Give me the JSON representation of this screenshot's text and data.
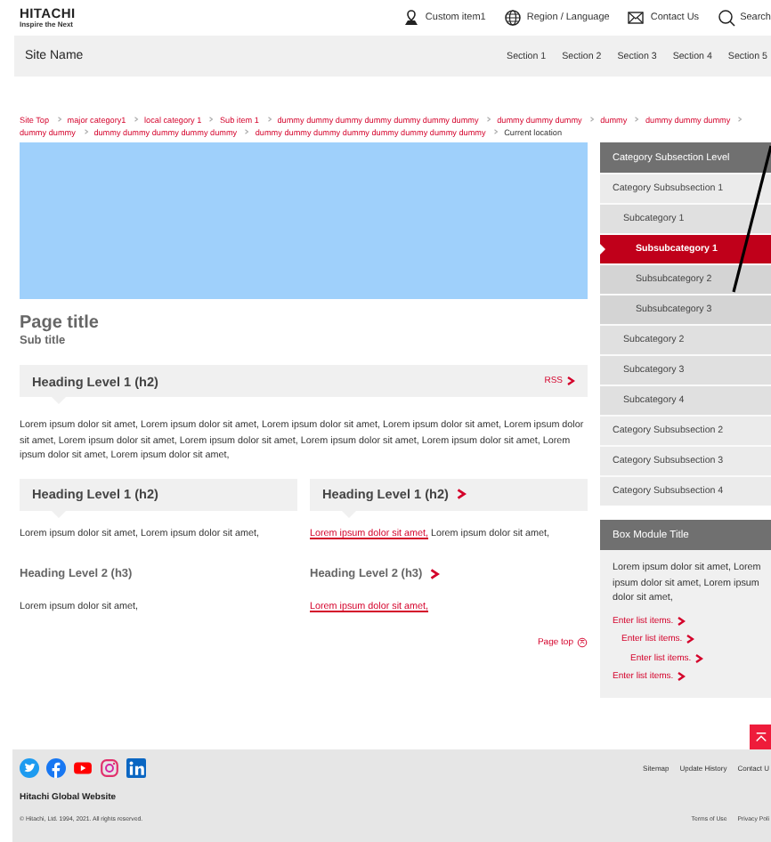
{
  "header": {
    "logo": "HITACHI",
    "tagline": "Inspire the Next",
    "utility_links": [
      {
        "label": "Custom item1",
        "kind": "pin"
      },
      {
        "label": "Region / Language",
        "kind": "globe"
      },
      {
        "label": "Contact Us",
        "kind": "mail"
      },
      {
        "label": "Search",
        "kind": "search"
      }
    ],
    "site_name": "Site Name",
    "sections": [
      "Section 1",
      "Section 2",
      "Section 3",
      "Section 4",
      "Section 5"
    ]
  },
  "breadcrumb": [
    {
      "label": "Site Top",
      "current": false
    },
    {
      "label": "major category1",
      "current": false
    },
    {
      "label": "local category 1",
      "current": false
    },
    {
      "label": "Sub item 1",
      "current": false
    },
    {
      "label": "dummy dummy dummy dummy dummy dummy dummy",
      "current": false
    },
    {
      "label": "dummy dummy dummy",
      "current": false
    },
    {
      "label": "dummy",
      "current": false
    },
    {
      "label": "dummy dummy dummy",
      "current": false
    },
    {
      "label": "dummy dummy",
      "current": false
    },
    {
      "label": "dummy dummy dummy dummy dummy",
      "current": false
    },
    {
      "label": "dummy dummy dummy dummy dummy dummy dummy dummy",
      "current": false
    },
    {
      "label": "Current location",
      "current": true
    }
  ],
  "page_title": "Page title",
  "sub_title": "Sub title",
  "section": {
    "heading": "Heading Level 1 (h2)",
    "rss": "RSS",
    "text": "Lorem ipsum dolor sit amet, Lorem ipsum dolor sit amet, Lorem ipsum dolor sit amet, Lorem ipsum dolor sit amet, Lorem ipsum dolor sit amet, Lorem ipsum dolor sit amet, Lorem ipsum dolor sit amet, Lorem ipsum dolor sit amet, Lorem ipsum dolor sit amet, Lorem ipsum dolor sit amet, Lorem ipsum dolor sit amet,"
  },
  "columns": [
    {
      "heading": "Heading Level 1 (h2)",
      "linked": false,
      "text": {
        "rest": "Lorem ipsum dolor sit amet, Lorem ipsum dolor sit amet,"
      },
      "subheading": "Heading Level 2 (h3)",
      "subtext": {
        "rest": "Lorem ipsum dolor sit amet,"
      }
    },
    {
      "heading": "Heading Level 1 (h2)",
      "linked": true,
      "text": {
        "link": "Lorem ipsum dolor sit amet,",
        "rest": " Lorem ipsum dolor sit amet,"
      },
      "subheading": "Heading Level 2 (h3)",
      "subtext": {
        "link": "Lorem ipsum dolor sit amet,"
      }
    }
  ],
  "page_top": "Page top",
  "sidebar": {
    "title": "Category Subsection Level",
    "items": [
      {
        "label": "Category Subsubsection 1",
        "selected": false,
        "children": [
          {
            "label": "Subcategory 1",
            "selected": false,
            "children": [
              {
                "label": "Subsubcategory 1",
                "selected": true
              },
              {
                "label": "Subsubcategory 2",
                "selected": false
              },
              {
                "label": "Subsubcategory 3",
                "selected": false
              }
            ]
          },
          {
            "label": "Subcategory 2",
            "selected": false
          },
          {
            "label": "Subcategory 3",
            "selected": false
          },
          {
            "label": "Subcategory 4",
            "selected": false
          }
        ]
      },
      {
        "label": "Category Subsubsection 2",
        "selected": false
      },
      {
        "label": "Category Subsubsection 3",
        "selected": false
      },
      {
        "label": "Category Subsubsection 4",
        "selected": false
      }
    ]
  },
  "box_module": {
    "title": "Box Module Title",
    "text": "Lorem ipsum dolor sit amet, Lorem ipsum dolor sit amet, Lorem ipsum dolor sit amet,",
    "links": [
      {
        "label": "Enter list items.",
        "children": [
          {
            "label": "Enter list items.",
            "children": [
              {
                "label": "Enter list items."
              }
            ]
          }
        ]
      },
      {
        "label": "Enter list items."
      }
    ]
  },
  "footer": {
    "links": [
      "Sitemap",
      "Update History",
      "Contact U"
    ],
    "site": "Hitachi Global Website",
    "copyright": "© Hitachi, Ltd. 1994, 2021. All rights reserved.",
    "legal": [
      "Terms of Use",
      "Privacy Poli"
    ]
  }
}
